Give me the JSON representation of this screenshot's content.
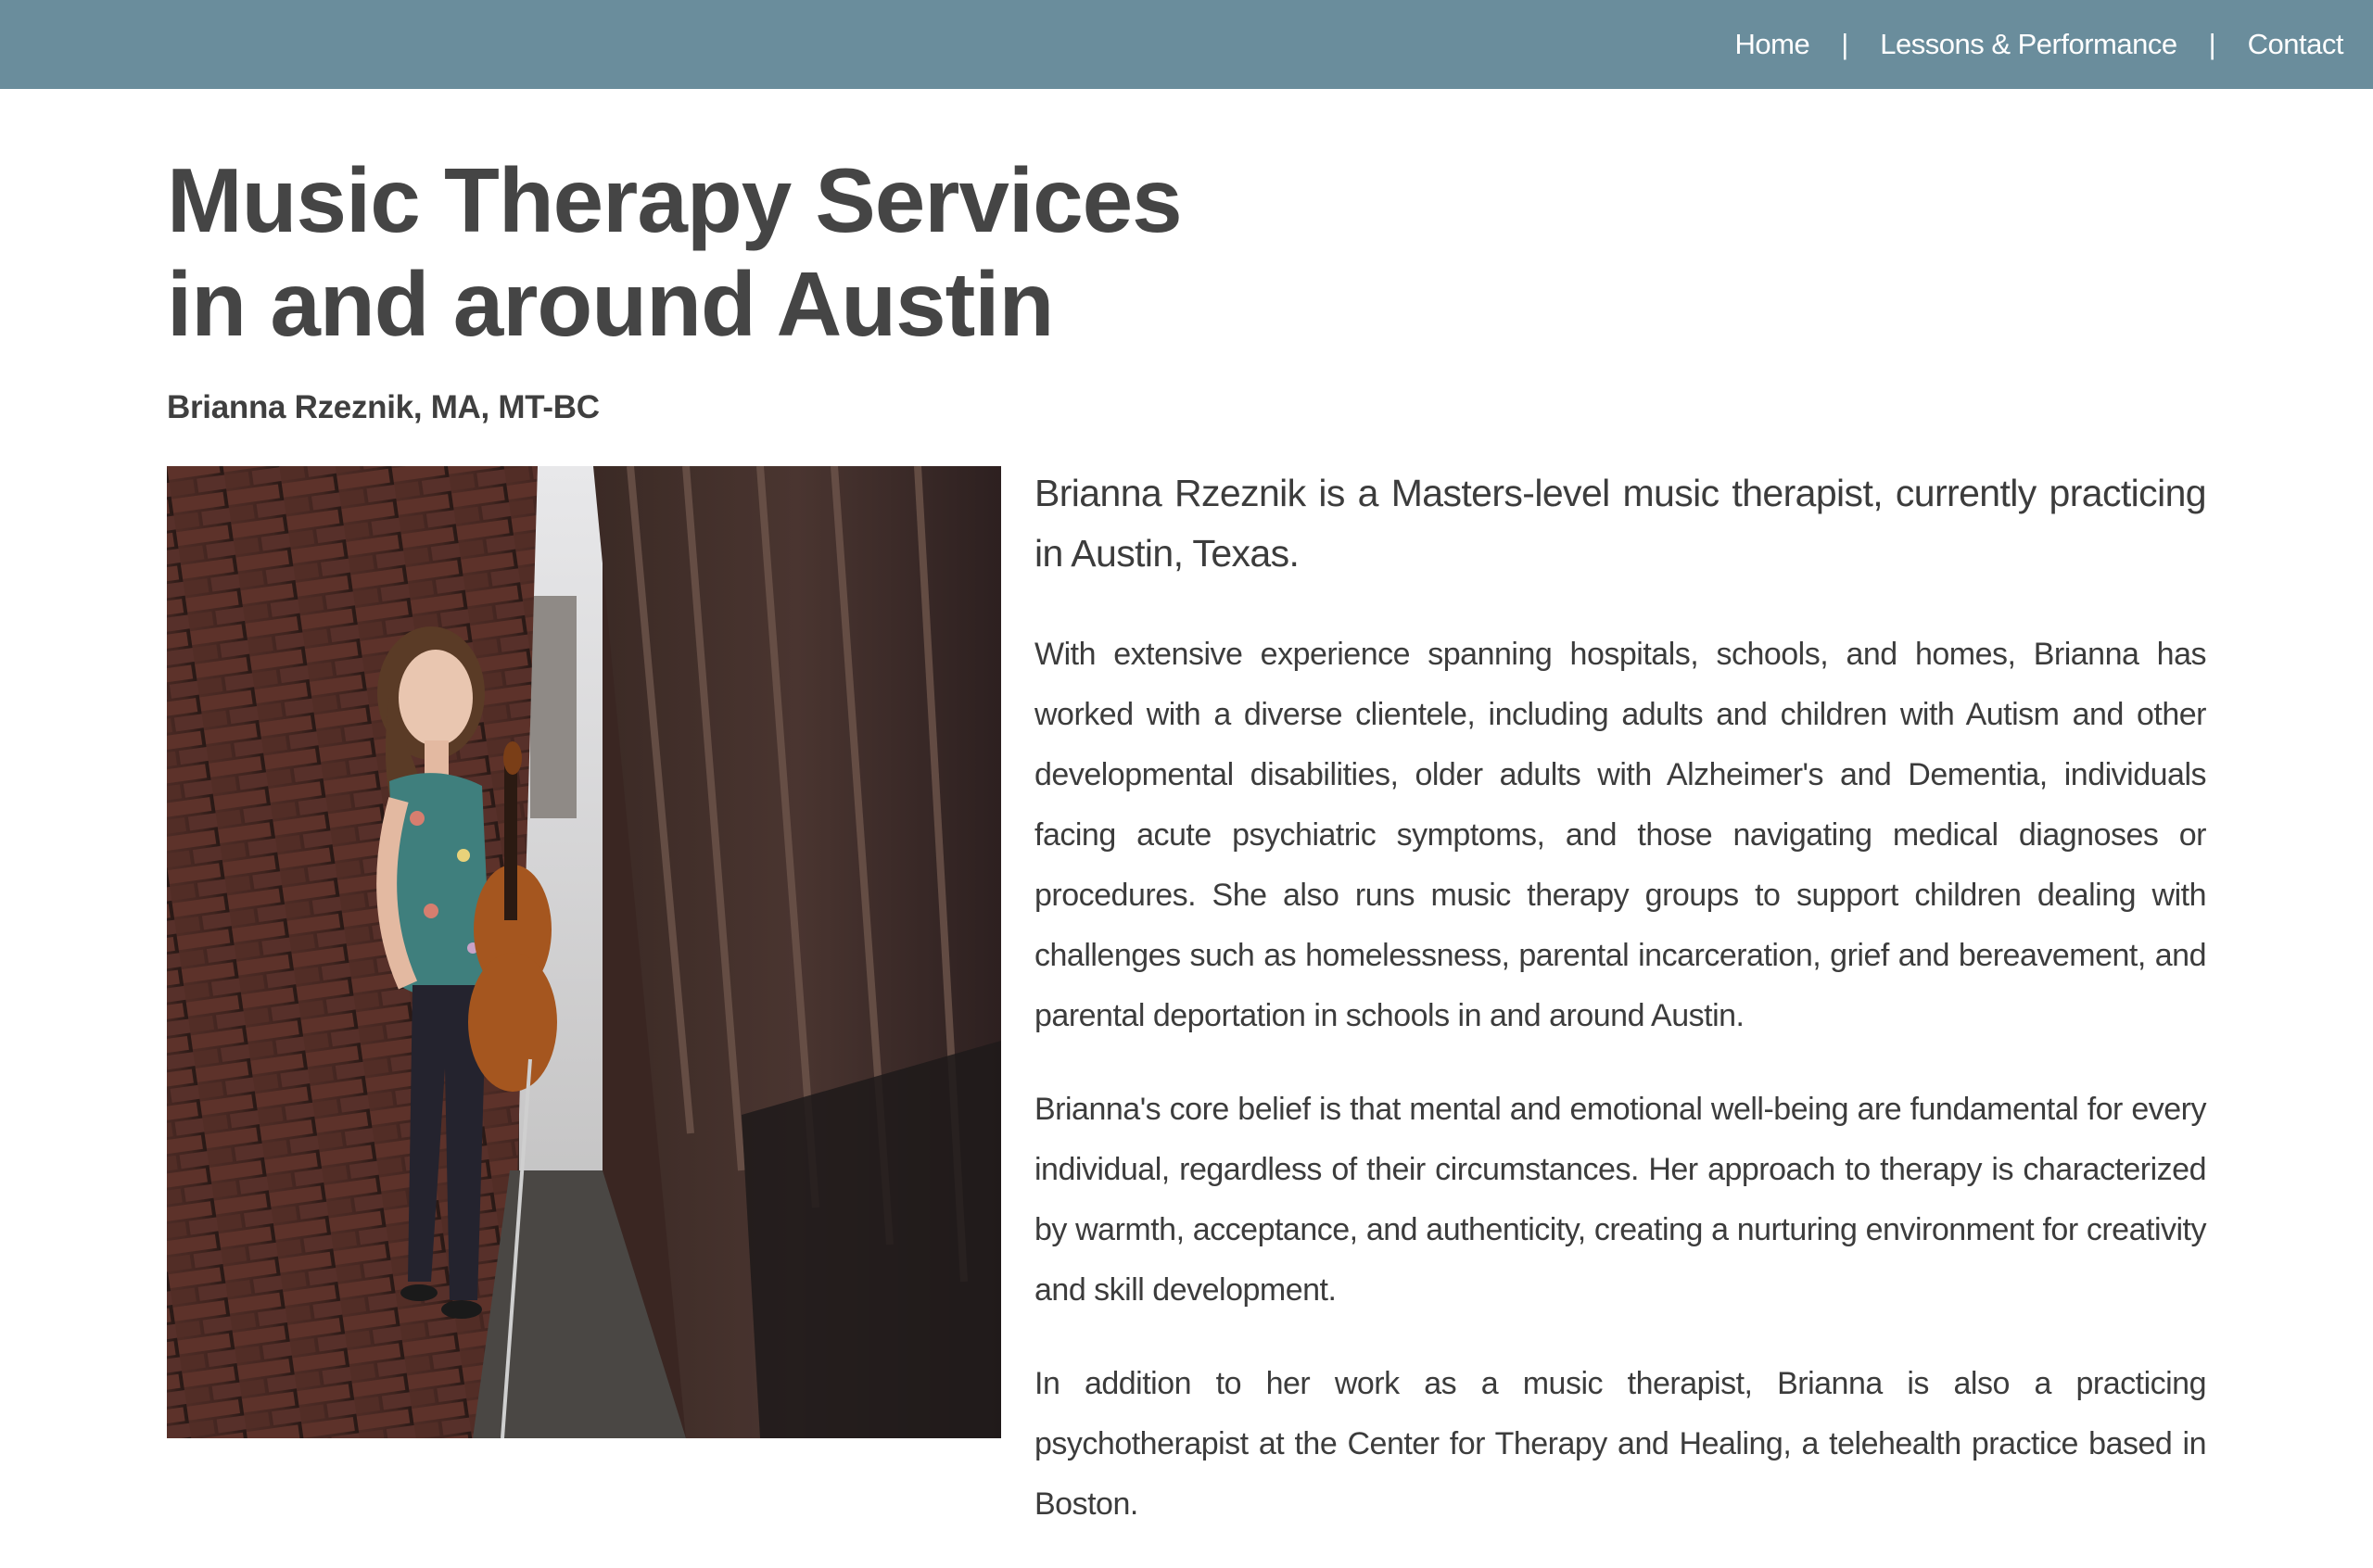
{
  "nav": {
    "items": [
      {
        "label": "Home"
      },
      {
        "label": "Lessons & Performance"
      },
      {
        "label": "Contact"
      }
    ],
    "separator": "|"
  },
  "header": {
    "title": "Music Therapy Services in and around Austin",
    "subtitle": "Brianna Rzeznik, MA, MT-BC"
  },
  "portrait": {
    "description_icon": "portrait-photo"
  },
  "content": {
    "lead": "Brianna Rzeznik is a Masters-level music therapist, currently practicing in Austin, Texas.",
    "paragraphs": [
      "With extensive experience spanning hospitals, schools, and homes, Brianna has worked with a diverse clientele, including adults and children with Autism and other developmental disabilities, older adults with Alzheimer's and Dementia, individuals facing acute psychiatric symptoms, and those navigating medical diagnoses or procedures. She also runs music therapy groups to support children dealing with challenges such as homelessness, parental incarceration, grief and bereavement, and parental deportation in schools in and around Austin.",
      "Brianna's core belief is that mental and emotional well-being are fundamental for every individual, regardless of their circumstances. Her approach to therapy is characterized by warmth, acceptance, and authenticity, creating a nurturing environment for creativity and skill development.",
      "In addition to her work as a music therapist, Brianna is also a practicing psychotherapist at the Center for Therapy and Healing, a telehealth practice based in Boston."
    ]
  },
  "colors": {
    "header_bg": "#6a8d9c",
    "text": "#3c3c3c",
    "title": "#454545"
  }
}
